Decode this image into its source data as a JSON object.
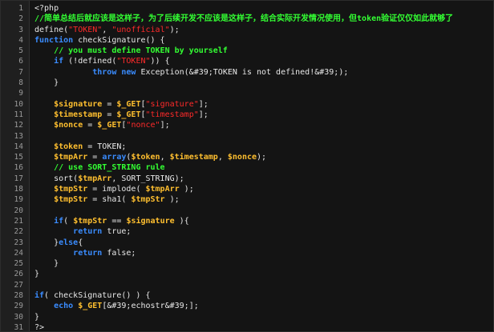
{
  "editor": {
    "language": "php",
    "colors": {
      "background": "#141414",
      "gutter_background": "#1f1f1f",
      "line_number": "#9a9a9a",
      "plain": "#e8e8e8",
      "keyword": "#3a8cff",
      "variable": "#ffbf2f",
      "string": "#ff2a2a",
      "comment": "#33ff33"
    },
    "lines": [
      {
        "number": "1",
        "tokens": [
          {
            "t": "plain",
            "v": "<?php"
          }
        ]
      },
      {
        "number": "2",
        "tokens": [
          {
            "t": "comment",
            "v": "//简单总结后就应该是这样子，为了后续开发不应该是这样子，结合实际开发情况使用，但token验证仅仅如此就够了"
          }
        ]
      },
      {
        "number": "3",
        "tokens": [
          {
            "t": "plain",
            "v": "define("
          },
          {
            "t": "string",
            "v": "\"TOKEN\""
          },
          {
            "t": "plain",
            "v": ", "
          },
          {
            "t": "string",
            "v": "\"unofficial\""
          },
          {
            "t": "plain",
            "v": ");"
          }
        ]
      },
      {
        "number": "4",
        "tokens": [
          {
            "t": "keyword",
            "v": "function"
          },
          {
            "t": "plain",
            "v": " checkSignature() {"
          }
        ]
      },
      {
        "number": "5",
        "tokens": [
          {
            "t": "plain",
            "v": "    "
          },
          {
            "t": "comment",
            "v": "// you must define TOKEN by yourself"
          }
        ]
      },
      {
        "number": "6",
        "tokens": [
          {
            "t": "plain",
            "v": "    "
          },
          {
            "t": "keyword",
            "v": "if"
          },
          {
            "t": "plain",
            "v": " (!defined("
          },
          {
            "t": "string",
            "v": "\"TOKEN\""
          },
          {
            "t": "plain",
            "v": ")) {"
          }
        ]
      },
      {
        "number": "7",
        "tokens": [
          {
            "t": "plain",
            "v": "            "
          },
          {
            "t": "keyword",
            "v": "throw"
          },
          {
            "t": "plain",
            "v": " "
          },
          {
            "t": "keyword",
            "v": "new"
          },
          {
            "t": "plain",
            "v": " Exception(&#39;TOKEN is not defined!&#39;);"
          }
        ]
      },
      {
        "number": "8",
        "tokens": [
          {
            "t": "plain",
            "v": "    }"
          }
        ]
      },
      {
        "number": "9",
        "tokens": [
          {
            "t": "plain",
            "v": ""
          }
        ]
      },
      {
        "number": "10",
        "tokens": [
          {
            "t": "plain",
            "v": "    "
          },
          {
            "t": "variable",
            "v": "$signature"
          },
          {
            "t": "plain",
            "v": " = "
          },
          {
            "t": "variable",
            "v": "$_GET"
          },
          {
            "t": "plain",
            "v": "["
          },
          {
            "t": "string",
            "v": "\"signature\""
          },
          {
            "t": "plain",
            "v": "];"
          }
        ]
      },
      {
        "number": "11",
        "tokens": [
          {
            "t": "plain",
            "v": "    "
          },
          {
            "t": "variable",
            "v": "$timestamp"
          },
          {
            "t": "plain",
            "v": " = "
          },
          {
            "t": "variable",
            "v": "$_GET"
          },
          {
            "t": "plain",
            "v": "["
          },
          {
            "t": "string",
            "v": "\"timestamp\""
          },
          {
            "t": "plain",
            "v": "];"
          }
        ]
      },
      {
        "number": "12",
        "tokens": [
          {
            "t": "plain",
            "v": "    "
          },
          {
            "t": "variable",
            "v": "$nonce"
          },
          {
            "t": "plain",
            "v": " = "
          },
          {
            "t": "variable",
            "v": "$_GET"
          },
          {
            "t": "plain",
            "v": "["
          },
          {
            "t": "string",
            "v": "\"nonce\""
          },
          {
            "t": "plain",
            "v": "];"
          }
        ]
      },
      {
        "number": "13",
        "tokens": [
          {
            "t": "plain",
            "v": ""
          }
        ]
      },
      {
        "number": "14",
        "tokens": [
          {
            "t": "plain",
            "v": "    "
          },
          {
            "t": "variable",
            "v": "$token"
          },
          {
            "t": "plain",
            "v": " = TOKEN;"
          }
        ]
      },
      {
        "number": "15",
        "tokens": [
          {
            "t": "plain",
            "v": "    "
          },
          {
            "t": "variable",
            "v": "$tmpArr"
          },
          {
            "t": "plain",
            "v": " = "
          },
          {
            "t": "keyword",
            "v": "array"
          },
          {
            "t": "plain",
            "v": "("
          },
          {
            "t": "variable",
            "v": "$token"
          },
          {
            "t": "plain",
            "v": ", "
          },
          {
            "t": "variable",
            "v": "$timestamp"
          },
          {
            "t": "plain",
            "v": ", "
          },
          {
            "t": "variable",
            "v": "$nonce"
          },
          {
            "t": "plain",
            "v": ");"
          }
        ]
      },
      {
        "number": "16",
        "tokens": [
          {
            "t": "plain",
            "v": "    "
          },
          {
            "t": "comment",
            "v": "// use SORT_STRING rule"
          }
        ]
      },
      {
        "number": "17",
        "tokens": [
          {
            "t": "plain",
            "v": "    sort("
          },
          {
            "t": "variable",
            "v": "$tmpArr"
          },
          {
            "t": "plain",
            "v": ", SORT_STRING);"
          }
        ]
      },
      {
        "number": "18",
        "tokens": [
          {
            "t": "plain",
            "v": "    "
          },
          {
            "t": "variable",
            "v": "$tmpStr"
          },
          {
            "t": "plain",
            "v": " = implode( "
          },
          {
            "t": "variable",
            "v": "$tmpArr"
          },
          {
            "t": "plain",
            "v": " );"
          }
        ]
      },
      {
        "number": "19",
        "tokens": [
          {
            "t": "plain",
            "v": "    "
          },
          {
            "t": "variable",
            "v": "$tmpStr"
          },
          {
            "t": "plain",
            "v": " = sha1( "
          },
          {
            "t": "variable",
            "v": "$tmpStr"
          },
          {
            "t": "plain",
            "v": " );"
          }
        ]
      },
      {
        "number": "20",
        "tokens": [
          {
            "t": "plain",
            "v": ""
          }
        ]
      },
      {
        "number": "21",
        "tokens": [
          {
            "t": "plain",
            "v": "    "
          },
          {
            "t": "keyword",
            "v": "if"
          },
          {
            "t": "plain",
            "v": "( "
          },
          {
            "t": "variable",
            "v": "$tmpStr"
          },
          {
            "t": "plain",
            "v": " == "
          },
          {
            "t": "variable",
            "v": "$signature"
          },
          {
            "t": "plain",
            "v": " ){"
          }
        ]
      },
      {
        "number": "22",
        "tokens": [
          {
            "t": "plain",
            "v": "        "
          },
          {
            "t": "keyword",
            "v": "return"
          },
          {
            "t": "plain",
            "v": " true;"
          }
        ]
      },
      {
        "number": "23",
        "tokens": [
          {
            "t": "plain",
            "v": "    }"
          },
          {
            "t": "keyword",
            "v": "else"
          },
          {
            "t": "plain",
            "v": "{"
          }
        ]
      },
      {
        "number": "24",
        "tokens": [
          {
            "t": "plain",
            "v": "        "
          },
          {
            "t": "keyword",
            "v": "return"
          },
          {
            "t": "plain",
            "v": " false;"
          }
        ]
      },
      {
        "number": "25",
        "tokens": [
          {
            "t": "plain",
            "v": "    }"
          }
        ]
      },
      {
        "number": "26",
        "tokens": [
          {
            "t": "plain",
            "v": "}"
          }
        ]
      },
      {
        "number": "27",
        "tokens": [
          {
            "t": "plain",
            "v": ""
          }
        ]
      },
      {
        "number": "28",
        "tokens": [
          {
            "t": "keyword",
            "v": "if"
          },
          {
            "t": "plain",
            "v": "( checkSignature() ) {"
          }
        ]
      },
      {
        "number": "29",
        "tokens": [
          {
            "t": "plain",
            "v": "    "
          },
          {
            "t": "keyword",
            "v": "echo"
          },
          {
            "t": "plain",
            "v": " "
          },
          {
            "t": "variable",
            "v": "$_GET"
          },
          {
            "t": "plain",
            "v": "[&#39;echostr&#39;];"
          }
        ]
      },
      {
        "number": "30",
        "tokens": [
          {
            "t": "plain",
            "v": "}"
          }
        ]
      },
      {
        "number": "31",
        "tokens": [
          {
            "t": "plain",
            "v": "?>"
          }
        ]
      }
    ]
  }
}
